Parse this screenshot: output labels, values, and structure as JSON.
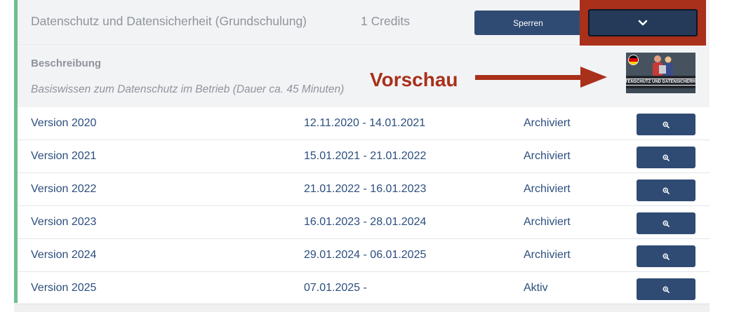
{
  "course": {
    "title": "Datenschutz und Datensicherheit (Grundschulung)",
    "credits": "1 Credits",
    "lock_label": "Sperren",
    "expand_icon": "chevron-down-icon"
  },
  "description": {
    "heading": "Beschreibung",
    "text": "Basiswissen zum Datenschutz im Betrieb (Dauer ca. 45 Minuten)"
  },
  "annotation": {
    "label": "Vorschau",
    "color": "#a9301a"
  },
  "thumbnail": {
    "banner_text": "DATENSCHUTZ UND DATENSICHERHEIT",
    "flag": "germany-flag-icon"
  },
  "versions": [
    {
      "name": "Version 2020",
      "period": "12.11.2020 - 14.01.2021",
      "status": "Archiviert"
    },
    {
      "name": "Version 2021",
      "period": "15.01.2021 - 21.01.2022",
      "status": "Archiviert"
    },
    {
      "name": "Version 2022",
      "period": "21.01.2022 - 16.01.2023",
      "status": "Archiviert"
    },
    {
      "name": "Version 2023",
      "period": "16.01.2023 - 28.01.2024",
      "status": "Archiviert"
    },
    {
      "name": "Version 2024",
      "period": "29.01.2024 - 06.01.2025",
      "status": "Archiviert"
    },
    {
      "name": "Version 2025",
      "period": "07.01.2025 -",
      "status": "Aktiv"
    }
  ],
  "colors": {
    "accent": "#6fbf8e",
    "button": "#2f4b73",
    "text_link": "#2c4e7e",
    "muted_text": "#8f949c"
  }
}
